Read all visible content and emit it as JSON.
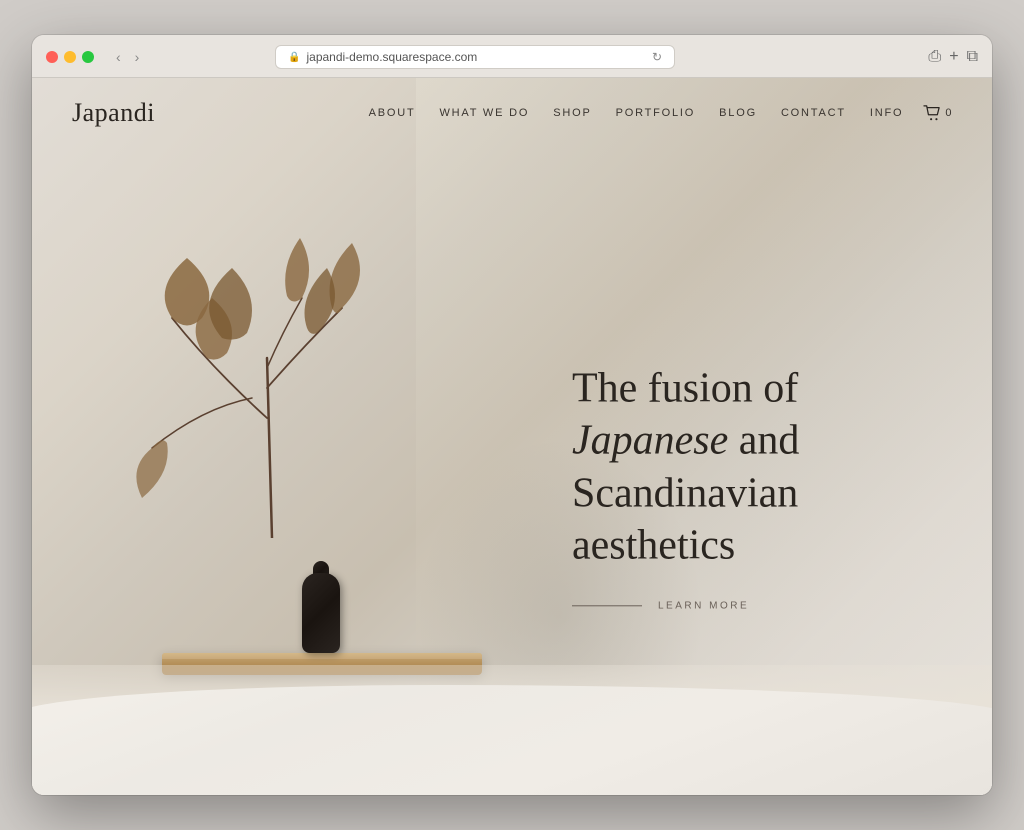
{
  "browser": {
    "url": "japandi-demo.squarespace.com",
    "back_label": "‹",
    "forward_label": "›",
    "share_label": "⎙",
    "new_tab_label": "+",
    "duplicate_label": "⧉"
  },
  "site": {
    "logo": "Japandi",
    "nav": {
      "items": [
        {
          "id": "about",
          "label": "ABOUT"
        },
        {
          "id": "what-we-do",
          "label": "WHAT WE DO"
        },
        {
          "id": "shop",
          "label": "SHOP"
        },
        {
          "id": "portfolio",
          "label": "PORTFOLIO"
        },
        {
          "id": "blog",
          "label": "BLOG"
        },
        {
          "id": "contact",
          "label": "CONTACT"
        },
        {
          "id": "info",
          "label": "INFO"
        }
      ],
      "cart_count": "0"
    },
    "hero": {
      "heading_normal": "The fusion of ",
      "heading_italic": "Japanese",
      "heading_rest": " and Scandinavian aesthetics",
      "learn_more_label": "LEARN MORE"
    }
  }
}
